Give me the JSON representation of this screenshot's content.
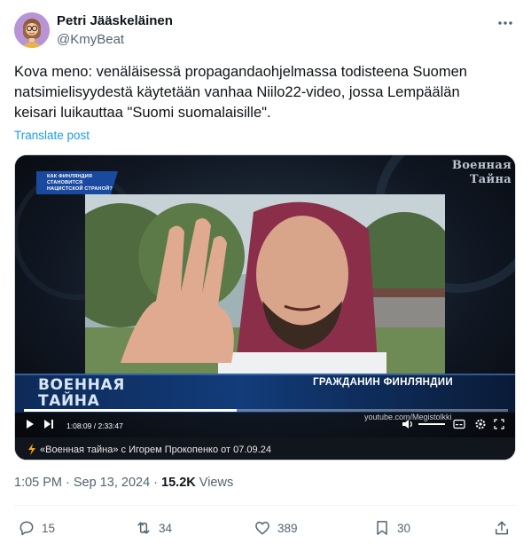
{
  "author": {
    "name": "Petri Jääskeläinen",
    "handle": "@KmyBeat"
  },
  "tweet": {
    "text_line1": "Kova meno: venäläisessä propagandaohjelmassa todisteena Suomen",
    "text_line2": "natsimielisyydestä käytetään vanhaa Niilo22-video, jossa Lempäälän",
    "text_line3": "keisari luikauttaa \"Suomi suomalaisille\".",
    "translate_label": "Translate post"
  },
  "media": {
    "topleft_badge": "Как Финляндия становится нацистской страной?",
    "channel_logo_line1": "Военная",
    "channel_logo_line2": "Тайна",
    "show_logo_line1": "ВОЕННАЯ",
    "show_logo_line2": "ТАЙНА",
    "caption": "ГРАЖДАНИН ФИНЛЯНДИИ",
    "watermark": "youtube.com/Megistolkki",
    "time_display": "1:08:09 / 2:33:47",
    "progress": 0.44,
    "source": "«Военная тайна» с Игорем Прокопенко от 07.09.24"
  },
  "meta": {
    "time": "1:05 PM · Sep 13, 2024 · ",
    "views_count": "15.2K",
    "views_label": " Views"
  },
  "actions": {
    "replies": "15",
    "reposts": "34",
    "likes": "389",
    "bookmarks": "30"
  },
  "colors": {
    "accent": "#1d9bf0",
    "secondary_text": "#536471",
    "primary_text": "#0f1419"
  }
}
